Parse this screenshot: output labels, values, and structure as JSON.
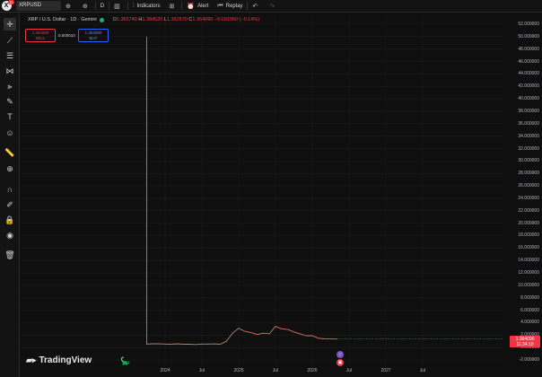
{
  "topbar": {
    "logo_text": "X",
    "badge_count": "11",
    "symbol": "XRPUSD",
    "interval": "D",
    "indicators_label": "Indicators",
    "alert_label": "Alert",
    "replay_label": "Replay"
  },
  "legend": {
    "title": "XRP / U.S. Dollar · 1D · Gemini",
    "o_label": "O",
    "o_value": "1.365740",
    "h_label": "H",
    "h_value": "1.384520",
    "l_label": "L",
    "l_value": "1.362570",
    "c_label": "C",
    "c_value": "1.364090",
    "change": "−0.001960 (−0.14%)",
    "sell_price": "1.364080",
    "sell_label": "SELL",
    "spread": "0.000010",
    "buy_price": "1.364090",
    "buy_label": "BUY"
  },
  "price_axis": {
    "labels": [
      "52.000000",
      "50.000000",
      "48.000000",
      "46.000000",
      "44.000000",
      "42.000000",
      "40.000000",
      "38.000000",
      "36.000000",
      "34.000000",
      "32.000000",
      "30.000000",
      "28.000000",
      "26.000000",
      "24.000000",
      "22.000000",
      "20.000000",
      "18.000000",
      "16.000000",
      "14.000000",
      "12.000000",
      "10.000000",
      "8.000000",
      "6.000000",
      "4.000000",
      "2.000000",
      "0.000000",
      "-2.000000"
    ],
    "current_price": "1.364090",
    "countdown": "11:34:10"
  },
  "time_axis": {
    "labels": [
      "2024",
      "Jul",
      "2025",
      "Jul",
      "2026",
      "Jul",
      "2027",
      "Jul"
    ]
  },
  "branding": {
    "name": "TradingView"
  },
  "colors": {
    "up": "#22ab94",
    "down": "#f23645",
    "accent": "#2962ff"
  },
  "chart_data": {
    "type": "line",
    "title": "XRP / U.S. Dollar · 1D · Gemini",
    "xlabel": "",
    "ylabel": "",
    "ylim": [
      -2,
      52
    ],
    "grid": true,
    "x_ticks": [
      "2024",
      "Jul",
      "2025",
      "Jul",
      "2026",
      "Jul",
      "2027",
      "Jul"
    ],
    "series": [
      {
        "x": [
          "2023-10",
          "2023-11",
          "2023-12",
          "2024-01",
          "2024-02",
          "2024-03",
          "2024-04",
          "2024-05",
          "2024-06",
          "2024-07",
          "2024-08",
          "2024-09",
          "2024-10",
          "2024-11",
          "2024-12",
          "2025-01",
          "2025-02",
          "2025-03",
          "2025-04",
          "2025-05",
          "2025-06",
          "2025-07",
          "2025-08",
          "2025-09",
          "2025-10",
          "2025-11",
          "2025-12",
          "2026-01",
          "2026-02",
          "2026-03",
          "2026-04",
          "2026-05"
        ],
        "values": [
          0.55,
          0.6,
          0.6,
          0.55,
          0.52,
          0.6,
          0.52,
          0.52,
          0.48,
          0.55,
          0.56,
          0.58,
          0.52,
          1.0,
          2.3,
          3.1,
          2.6,
          2.4,
          2.1,
          2.3,
          2.2,
          3.4,
          3.0,
          2.9,
          2.5,
          2.2,
          1.9,
          1.9,
          1.5,
          1.4,
          1.38,
          1.364
        ]
      }
    ]
  }
}
